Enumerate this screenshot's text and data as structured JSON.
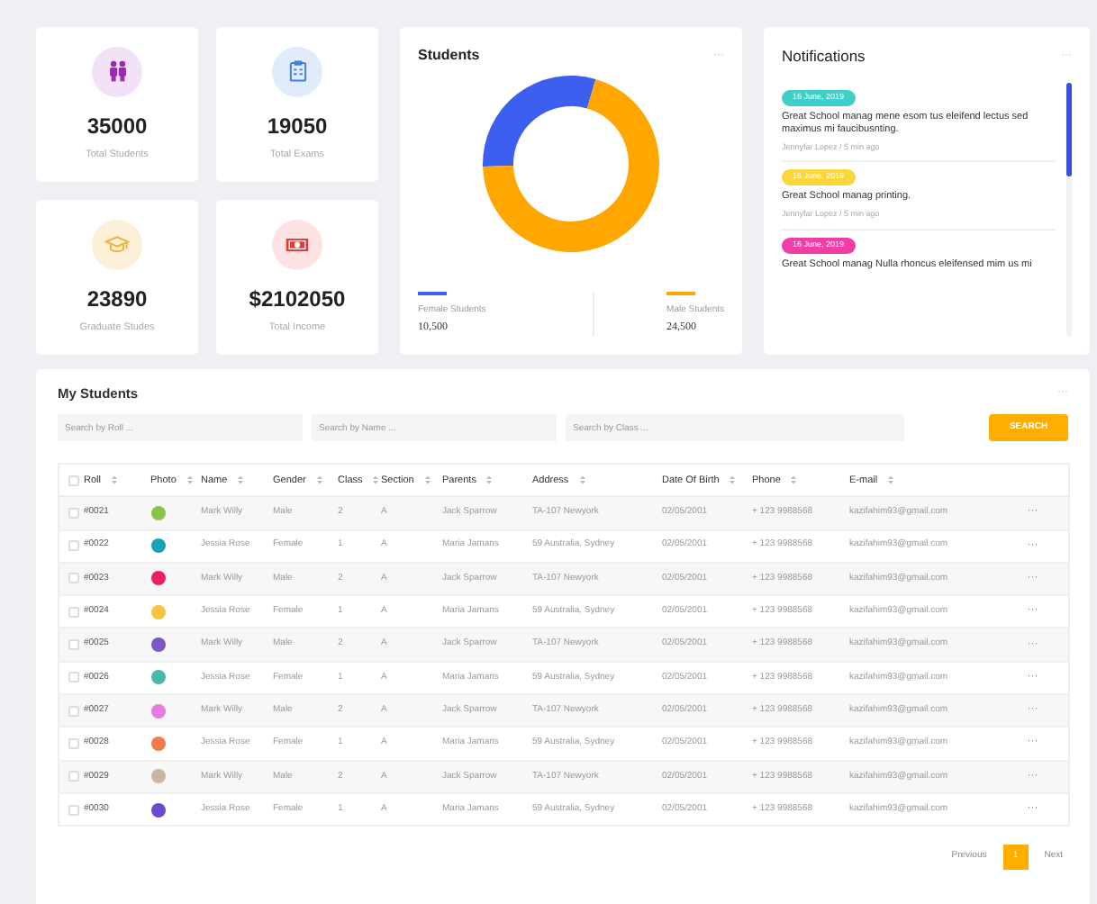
{
  "stats": [
    {
      "value": "35000",
      "label": "Total Students",
      "kind": "students",
      "color": "#f3e1f8"
    },
    {
      "value": "19050",
      "label": "Total Exams",
      "kind": "exams",
      "color": "#e1ecfb"
    },
    {
      "value": "23890",
      "label": "Graduate Studes",
      "kind": "graduates",
      "color": "#fdf0d8"
    },
    {
      "value": "$2102050",
      "label": "Total Income",
      "kind": "income",
      "color": "#fde3e3"
    }
  ],
  "students_card": {
    "title": "Students",
    "menu": "···",
    "chart_data": {
      "type": "donut",
      "values": [
        30,
        70
      ]
    },
    "legend": [
      {
        "label": "Female Students",
        "value": "10,500",
        "color": "#3c5ff0"
      },
      {
        "label": "Male Students",
        "value": "24,500",
        "color": "#ffa601"
      }
    ]
  },
  "notifications": {
    "title": "Notifications",
    "menu": "···",
    "items": [
      {
        "date": "16 June, 2019",
        "color": "#3ed0c8",
        "text": "Great School manag mene esom tus eleifend lectus sed maximus mi faucibusnting.",
        "meta": "Jennyfar Lopez / 5 min ago"
      },
      {
        "date": "16 June, 2019",
        "color": "#fbd73a",
        "text": "Great School manag printing.",
        "meta": "Jennyfar Lopez / 5 min ago"
      },
      {
        "date": "16 June, 2019",
        "color": "#f23ca6",
        "text": "Great School manag Nulla rhoncus eleifensed mim us mi"
      }
    ]
  },
  "my_students": {
    "title": "My Students",
    "menu": "···",
    "filters": [
      {
        "placeholder": "Search by Roll ..."
      },
      {
        "placeholder": "Search by Name ..."
      },
      {
        "placeholder": "Search by Class ..."
      }
    ],
    "search_button": "SEARCH",
    "columns": [
      "Roll",
      "Photo",
      "Name",
      "Gender",
      "Class",
      "Section",
      "Parents",
      "Address",
      "Date Of Birth",
      "Phone",
      "E-mail"
    ],
    "header_checked": false,
    "rows": [
      {
        "checked": false,
        "roll": "#0021",
        "color": "#8bc34a",
        "name": "Mark Willy",
        "gender": "Male",
        "class": "2",
        "section": "A",
        "parents": "Jack Sparrow",
        "address": "TA-107 Newyork",
        "dob": "02/05/2001",
        "phone": "+ 123 9988568",
        "email": "kazifahim93@gmail.com",
        "action": "···"
      },
      {
        "checked": false,
        "roll": "#0022",
        "color": "#17a2b8",
        "name": "Jessia Rose",
        "gender": "Female",
        "class": "1",
        "section": "A",
        "parents": "Maria Jamans",
        "address": "59 Australia, Sydney",
        "dob": "02/05/2001",
        "phone": "+ 123 9988568",
        "email": "kazifahim93@gmail.com",
        "action": "···"
      },
      {
        "checked": false,
        "roll": "#0023",
        "color": "#e91e63",
        "name": "Mark Willy",
        "gender": "Male",
        "class": "2",
        "section": "A",
        "parents": "Jack Sparrow",
        "address": "TA-107 Newyork",
        "dob": "02/05/2001",
        "phone": "+ 123 9988568",
        "email": "kazifahim93@gmail.com",
        "action": "···"
      },
      {
        "checked": false,
        "roll": "#0024",
        "color": "#f5c242",
        "name": "Jessia Rose",
        "gender": "Female",
        "class": "1",
        "section": "A",
        "parents": "Maria Jamans",
        "address": "59 Australia, Sydney",
        "dob": "02/05/2001",
        "phone": "+ 123 9988568",
        "email": "kazifahim93@gmail.com",
        "action": "···"
      },
      {
        "checked": false,
        "roll": "#0025",
        "color": "#7e57c2",
        "name": "Mark Willy",
        "gender": "Male",
        "class": "2",
        "section": "A",
        "parents": "Jack Sparrow",
        "address": "TA-107 Newyork",
        "dob": "02/05/2001",
        "phone": "+ 123 9988568",
        "email": "kazifahim93@gmail.com",
        "action": "···"
      },
      {
        "checked": false,
        "roll": "#0026",
        "color": "#4db6ac",
        "name": "Jessia Rose",
        "gender": "Female",
        "class": "1",
        "section": "A",
        "parents": "Maria Jamans",
        "address": "59 Australia, Sydney",
        "dob": "02/05/2001",
        "phone": "+ 123 9988568",
        "email": "kazifahim93@gmail.com",
        "action": "···"
      },
      {
        "checked": false,
        "roll": "#0027",
        "color": "#e57de0",
        "name": "Mark Willy",
        "gender": "Male",
        "class": "2",
        "section": "A",
        "parents": "Jack Sparrow",
        "address": "TA-107 Newyork",
        "dob": "02/05/2001",
        "phone": "+ 123 9988568",
        "email": "kazifahim93@gmail.com",
        "action": "···"
      },
      {
        "checked": false,
        "roll": "#0028",
        "color": "#f07a4a",
        "name": "Jessia Rose",
        "gender": "Female",
        "class": "1",
        "section": "A",
        "parents": "Maria Jamans",
        "address": "59 Australia, Sydney",
        "dob": "02/05/2001",
        "phone": "+ 123 9988568",
        "email": "kazifahim93@gmail.com",
        "action": "···"
      },
      {
        "checked": false,
        "roll": "#0029",
        "color": "#c8b7a0",
        "name": "Mark Willy",
        "gender": "Male",
        "class": "2",
        "section": "A",
        "parents": "Jack Sparrow",
        "address": "TA-107 Newyork",
        "dob": "02/05/2001",
        "phone": "+ 123 9988568",
        "email": "kazifahim93@gmail.com",
        "action": "···"
      },
      {
        "checked": false,
        "roll": "#0030",
        "color": "#6a4bd0",
        "name": "Jessia Rose",
        "gender": "Female",
        "class": "1",
        "section": "A",
        "parents": "Maria Jamans",
        "address": "59 Australia, Sydney",
        "dob": "02/05/2001",
        "phone": "+ 123 9988568",
        "email": "kazifahim93@gmail.com",
        "action": "···"
      }
    ],
    "pagination": [
      {
        "label": "Previous",
        "selected": false
      },
      {
        "label": "1",
        "selected": true
      },
      {
        "label": "Next",
        "selected": false
      }
    ]
  }
}
